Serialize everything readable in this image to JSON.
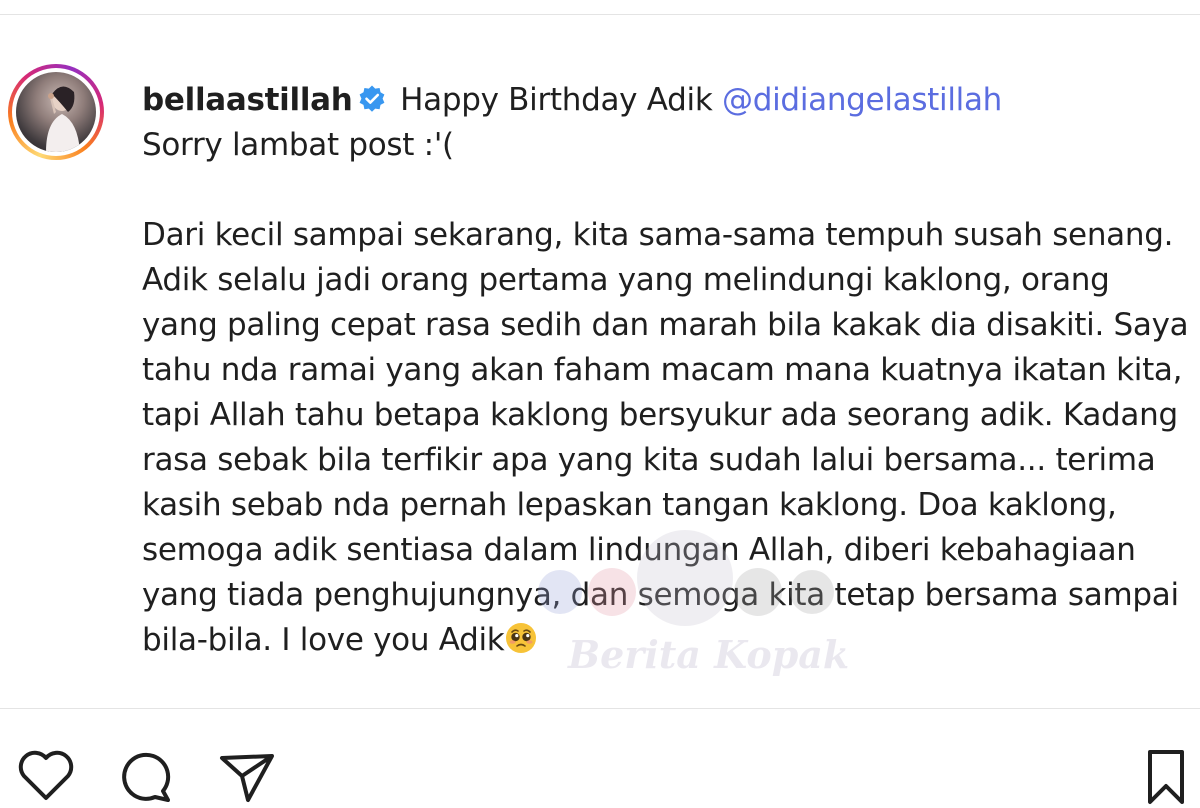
{
  "post": {
    "username": "bellaastillah",
    "verified": true,
    "caption_start": "Happy Birthday Adik",
    "mention": "@didiangelastillah",
    "lines": [
      "Sorry lambat post :'(",
      "",
      "Dari kecil sampai sekarang, kita sama-sama tempuh susah senang.",
      "Adik selalu jadi orang pertama yang melindungi kaklong, orang",
      "yang paling cepat rasa sedih dan marah bila kakak dia disakiti. Saya",
      "tahu nda ramai yang akan faham macam mana kuatnya ikatan kita,",
      "tapi Allah tahu betapa kaklong bersyukur ada seorang adik. Kadang",
      "rasa sebak bila terfikir apa yang kita sudah lalui bersama... terima",
      "kasih sebab nda pernah lepaskan tangan kaklong. Doa kaklong,",
      "semoga adik sentiasa dalam lindungan Allah, diberi kebahagiaan",
      "yang tiada penghujungnya, dan semoga kita tetap bersama sampai"
    ],
    "last_line": "bila-bila. I love you Adik",
    "emoji": "pleading-face-emoji"
  },
  "watermark": {
    "text": "Berita Kopak"
  },
  "actions": {
    "icons": [
      "heart-icon",
      "comment-icon",
      "share-icon",
      "bookmark-icon"
    ]
  },
  "colors": {
    "text": "#1f1f1f",
    "mention": "#5b6de0",
    "verified": "#3897f0",
    "divider": "#e4e4e4"
  }
}
